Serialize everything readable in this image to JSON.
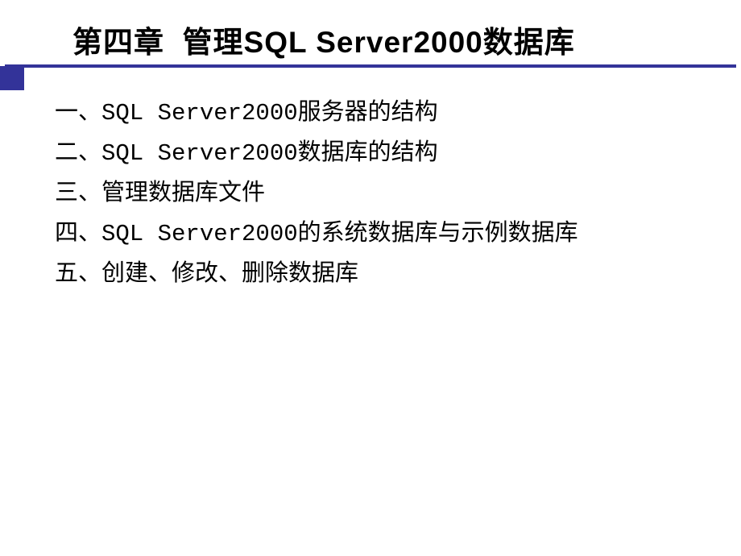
{
  "slide": {
    "title": "第四章  管理SQL Server2000数据库",
    "items": [
      "一、SQL Server2000服务器的结构",
      "二、SQL Server2000数据库的结构",
      "三、管理数据库文件",
      "四、SQL Server2000的系统数据库与示例数据库",
      "五、创建、修改、删除数据库"
    ]
  }
}
